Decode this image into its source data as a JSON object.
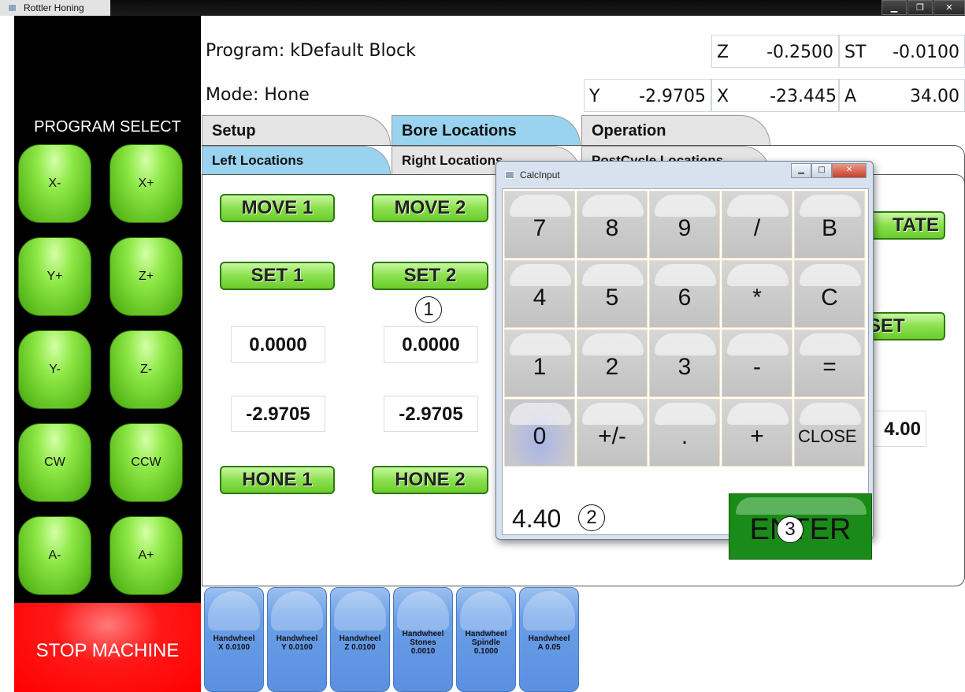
{
  "window": {
    "title": "Rottler Honing",
    "minimize": "▁",
    "maximize": "❐",
    "close": "✕"
  },
  "left": {
    "program_select": "PROGRAM SELECT",
    "jog": {
      "x_minus": "X-",
      "x_plus": "X+",
      "y_plus": "Y+",
      "z_plus": "Z+",
      "y_minus": "Y-",
      "z_minus": "Z-",
      "cw": "CW",
      "ccw": "CCW",
      "a_minus": "A-",
      "a_plus": "A+"
    },
    "stop": "STOP MACHINE"
  },
  "header": {
    "program": "Program: kDefault Block",
    "mode": "Mode: Hone",
    "coords": {
      "z": {
        "axis": "Z",
        "value": "-0.2500"
      },
      "st": {
        "axis": "ST",
        "value": "-0.0100"
      },
      "y": {
        "axis": "Y",
        "value": "-2.9705"
      },
      "x": {
        "axis": "X",
        "value": "-23.445"
      },
      "a": {
        "axis": "A",
        "value": "34.00"
      }
    }
  },
  "tabs": {
    "setup": "Setup",
    "bore_locations": "Bore Locations",
    "operation": "Operation"
  },
  "subtabs": {
    "left": "Left Locations",
    "right": "Right Locations",
    "postcycle": "PostCycle Locations"
  },
  "locations": {
    "move1": "MOVE 1",
    "move2": "MOVE 2",
    "set1": "SET 1",
    "set2": "SET 2",
    "val1a": "0.0000",
    "val2a": "0.0000",
    "val1b": "-2.9705",
    "val2b": "-2.9705",
    "hone1": "HONE 1",
    "hone2": "HONE 2",
    "rotate_partial": "TATE",
    "set_partial": "SET",
    "value_partial": "4.00"
  },
  "handwheels": [
    {
      "line1": "Handwheel",
      "line2": "X 0.0100",
      "line3": ""
    },
    {
      "line1": "Handwheel",
      "line2": "Y 0.0100",
      "line3": ""
    },
    {
      "line1": "Handwheel",
      "line2": "Z 0.0100",
      "line3": ""
    },
    {
      "line1": "Handwheel",
      "line2": "Stones",
      "line3": "0.0010"
    },
    {
      "line1": "Handwheel",
      "line2": "Spindle",
      "line3": "0.1000"
    },
    {
      "line1": "Handwheel",
      "line2": "A 0.05",
      "line3": ""
    }
  ],
  "calc": {
    "title": "CalcInput",
    "keys": [
      "7",
      "8",
      "9",
      "/",
      "B",
      "4",
      "5",
      "6",
      "*",
      "C",
      "1",
      "2",
      "3",
      "-",
      "=",
      "0",
      "+/-",
      ".",
      "+",
      "CLOSE"
    ],
    "display": "4.40",
    "enter": "ENTER"
  },
  "markers": {
    "m1": "1",
    "m2": "2",
    "m3": "3"
  }
}
